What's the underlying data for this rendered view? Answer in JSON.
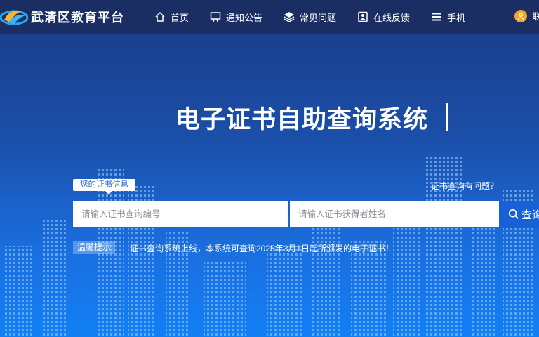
{
  "header": {
    "brand": "武清区教育平台",
    "nav": [
      {
        "label": "首页",
        "icon": "home-icon"
      },
      {
        "label": "通知公告",
        "icon": "notice-board-icon"
      },
      {
        "label": "常见问题",
        "icon": "layers-icon"
      },
      {
        "label": "在线反馈",
        "icon": "feedback-icon"
      },
      {
        "label": "手机",
        "icon": "menu-icon"
      }
    ],
    "contact_label": "联"
  },
  "hero": {
    "title": "电子证书自助查询系统"
  },
  "search": {
    "tag": "您的证书信息",
    "help_link": "证书查询有问题？",
    "cert_no_placeholder": "请输入证书查询编号",
    "holder_placeholder": "请输入证书获得者姓名",
    "button_label": "查询"
  },
  "notice": {
    "label": "温馨提示",
    "text": "证书查询系统上线，本系统可查询2025年3月1日起所颁发的电子证书！"
  },
  "colors": {
    "topbar": "#1a2e63",
    "accent_button": "#1860d8",
    "contact_icon": "#f5a623"
  }
}
